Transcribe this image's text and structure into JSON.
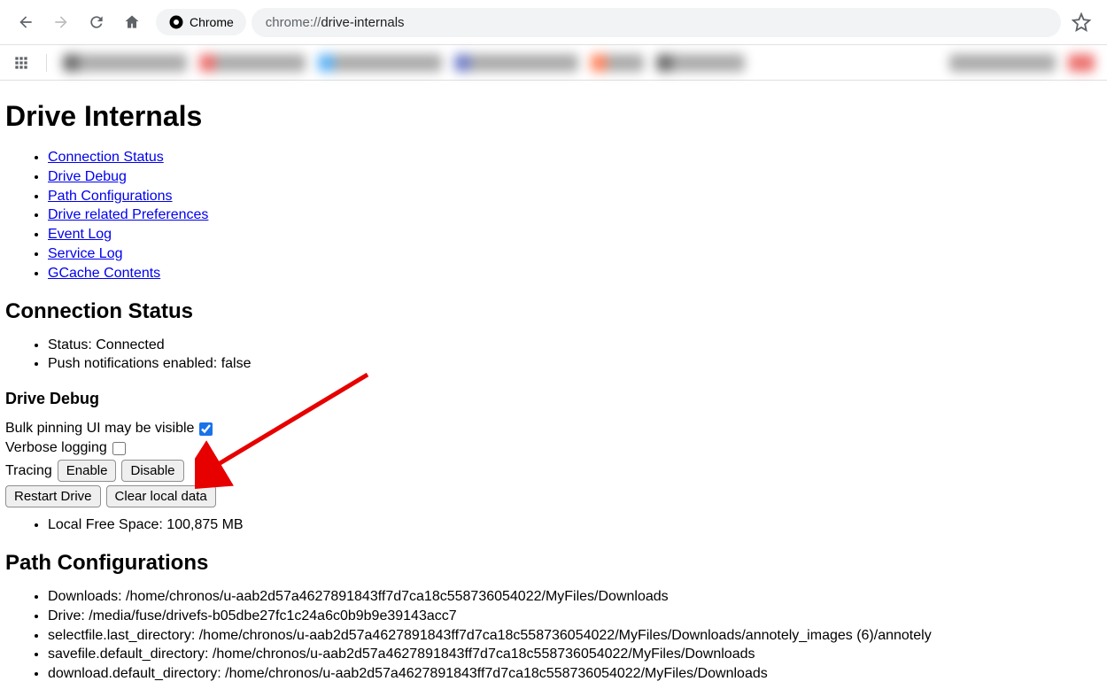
{
  "browser": {
    "chip_label": "Chrome",
    "url_scheme": "chrome://",
    "url_path": "drive-internals"
  },
  "page": {
    "title": "Drive Internals",
    "nav_links": [
      "Connection Status",
      "Drive Debug",
      "Path Configurations",
      "Drive related Preferences",
      "Event Log",
      "Service Log",
      "GCache Contents"
    ]
  },
  "connection_status": {
    "heading": "Connection Status",
    "items": [
      "Status: Connected",
      "Push notifications enabled: false"
    ]
  },
  "drive_debug": {
    "heading": "Drive Debug",
    "bulk_pinning_label": "Bulk pinning UI may be visible",
    "verbose_logging_label": "Verbose logging",
    "tracing_label": "Tracing",
    "enable_button": "Enable",
    "disable_button": "Disable",
    "restart_button": "Restart Drive",
    "clear_button": "Clear local data",
    "local_free_space": "Local Free Space: 100,875 MB"
  },
  "path_config": {
    "heading": "Path Configurations",
    "items": [
      "Downloads: /home/chronos/u-aab2d57a4627891843ff7d7ca18c558736054022/MyFiles/Downloads",
      "Drive: /media/fuse/drivefs-b05dbe27fc1c24a6c0b9b9e39143acc7",
      "selectfile.last_directory: /home/chronos/u-aab2d57a4627891843ff7d7ca18c558736054022/MyFiles/Downloads/annotely_images (6)/annotely",
      "savefile.default_directory: /home/chronos/u-aab2d57a4627891843ff7d7ca18c558736054022/MyFiles/Downloads",
      "download.default_directory: /home/chronos/u-aab2d57a4627891843ff7d7ca18c558736054022/MyFiles/Downloads"
    ]
  }
}
